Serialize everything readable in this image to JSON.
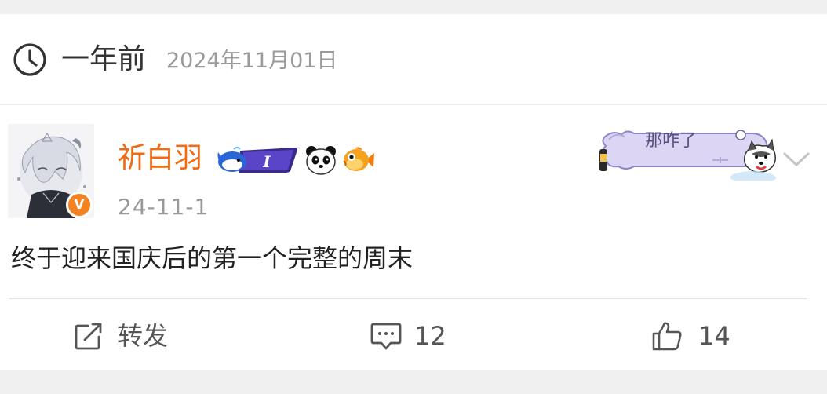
{
  "header": {
    "relative_time": "一年前",
    "absolute_date": "2024年11月01日"
  },
  "post": {
    "author": {
      "name": "祈白羽",
      "verified_badge": "V",
      "whale_badge_text": "I",
      "name_color": "#f06b13"
    },
    "date": "24-11-1",
    "sticker_text": "那咋了",
    "content": "终于迎来国庆后的第一个完整的周末"
  },
  "actions": {
    "repost_label": "转发",
    "comment_count": "12",
    "like_count": "14"
  },
  "icons": [
    "clock-icon",
    "verified-badge",
    "whale-badge",
    "panda-icon",
    "fish-icon",
    "chevron-down-icon",
    "repost-icon",
    "comment-icon",
    "like-icon"
  ]
}
